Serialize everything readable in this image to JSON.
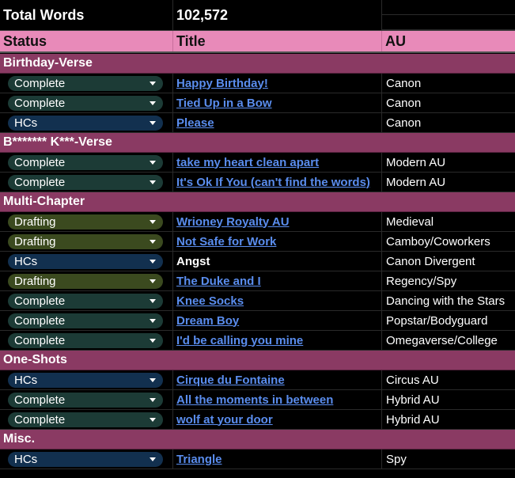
{
  "summary": {
    "label": "Total Words",
    "value": "102,572"
  },
  "header": {
    "status": "Status",
    "title": "Title",
    "au": "AU"
  },
  "colors": {
    "header_bg": "#e88ab9",
    "section_bg": "#8a3a63",
    "link": "#5a8dee",
    "complete_chip": "#1c3b36",
    "drafting_chip": "#3b4a1f",
    "hcs_chip": "#12304f"
  },
  "sections": [
    {
      "name": "Birthday-Verse",
      "rows": [
        {
          "status": "Complete",
          "title": "Happy Birthday!",
          "au": "Canon",
          "link": true
        },
        {
          "status": "Complete",
          "title": "Tied Up in a Bow",
          "au": "Canon",
          "link": true
        },
        {
          "status": "HCs",
          "title": "Please",
          "au": "Canon",
          "link": true
        }
      ]
    },
    {
      "name": "B******* K***-Verse",
      "rows": [
        {
          "status": "Complete",
          "title": "take my heart clean apart",
          "au": "Modern AU",
          "link": true
        },
        {
          "status": "Complete",
          "title": "It's Ok If You (can't find the words)",
          "au": "Modern AU",
          "link": true
        }
      ]
    },
    {
      "name": "Multi-Chapter",
      "rows": [
        {
          "status": "Drafting",
          "title": "Wrioney Royalty AU",
          "au": "Medieval",
          "link": true
        },
        {
          "status": "Drafting",
          "title": "Not Safe for Work",
          "au": "Camboy/Coworkers",
          "link": true
        },
        {
          "status": "HCs",
          "title": "Angst",
          "au": "Canon Divergent",
          "link": false
        },
        {
          "status": "Drafting",
          "title": "The Duke and I",
          "au": "Regency/Spy",
          "link": true
        },
        {
          "status": "Complete",
          "title": "Knee Socks",
          "au": "Dancing with the Stars",
          "link": true
        },
        {
          "status": "Complete",
          "title": "Dream Boy",
          "au": "Popstar/Bodyguard",
          "link": true
        },
        {
          "status": "Complete",
          "title": "I'd be calling you mine",
          "au": "Omegaverse/College",
          "link": true
        }
      ]
    },
    {
      "name": "One-Shots",
      "rows": [
        {
          "status": "HCs",
          "title": "Cirque du Fontaine",
          "au": "Circus AU",
          "link": true
        },
        {
          "status": "Complete",
          "title": "All the moments in between",
          "au": "Hybrid AU",
          "link": true
        },
        {
          "status": "Complete",
          "title": "wolf at your door",
          "au": "Hybrid AU",
          "link": true
        }
      ]
    },
    {
      "name": "Misc.",
      "rows": [
        {
          "status": "HCs",
          "title": "Triangle",
          "au": "Spy",
          "link": true
        }
      ]
    }
  ]
}
